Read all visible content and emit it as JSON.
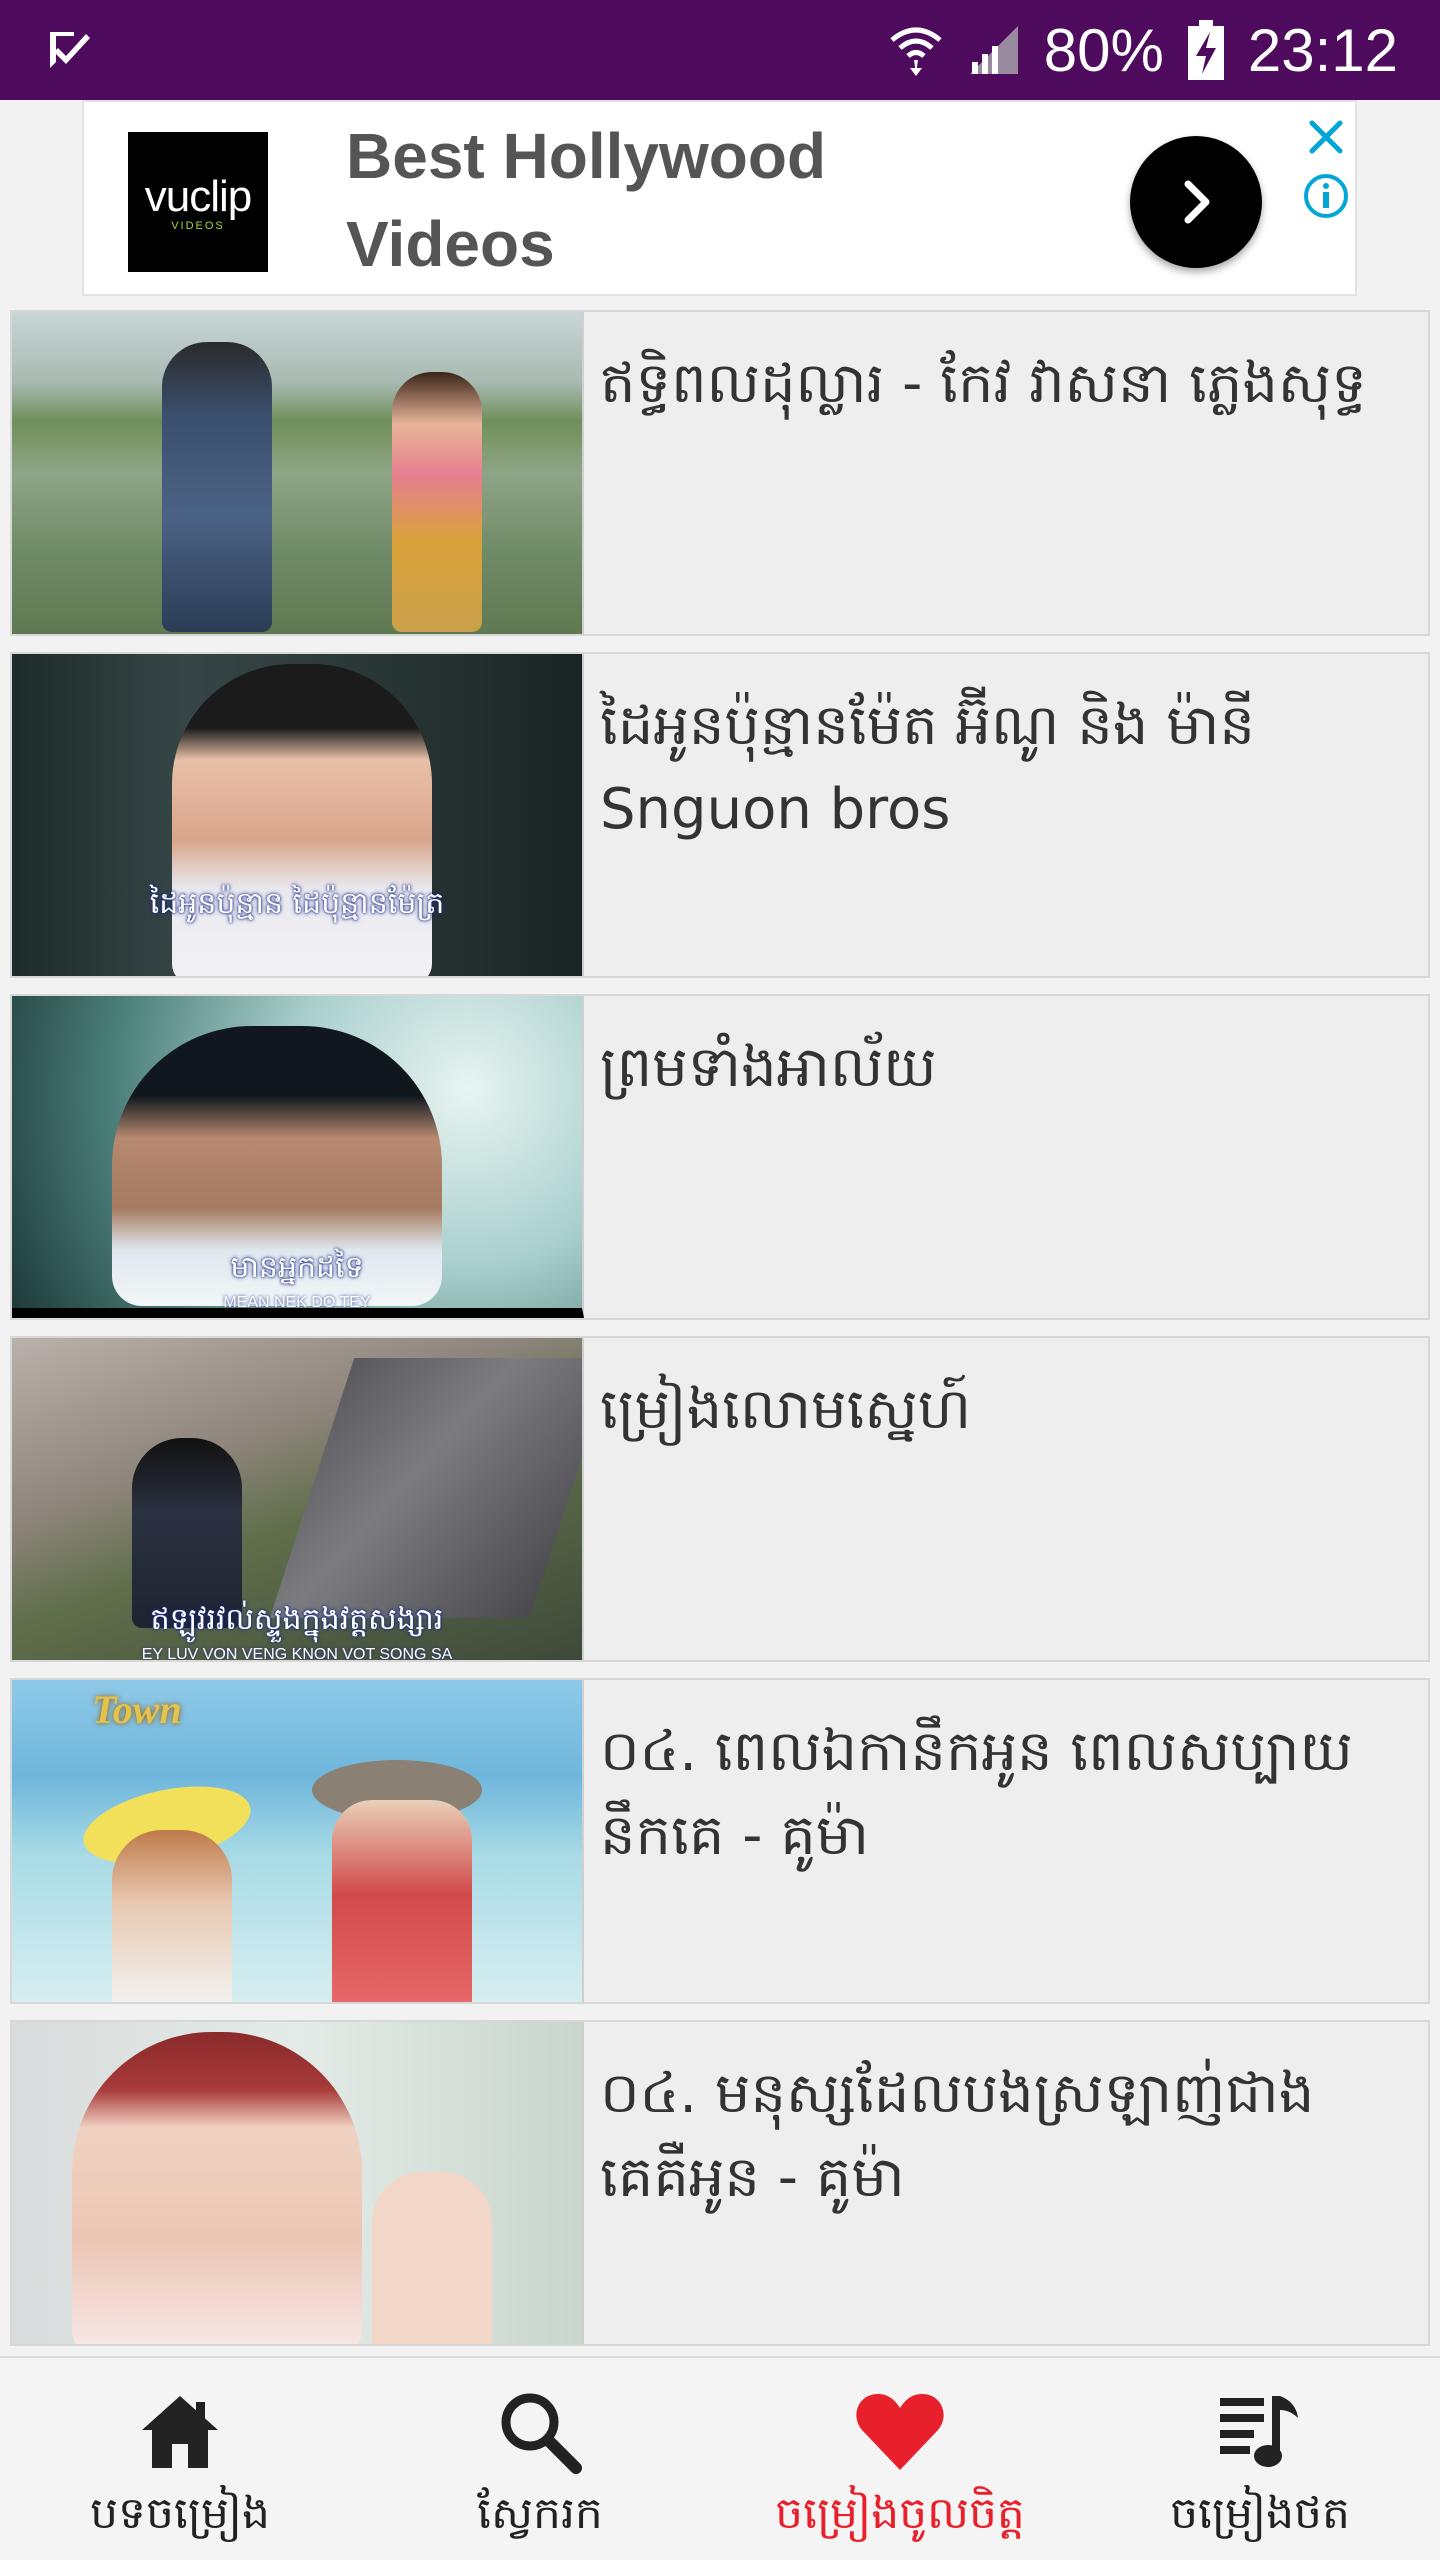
{
  "status_bar": {
    "battery": "80%",
    "time": "23:12",
    "background": "#4e0a5c"
  },
  "ad": {
    "logo_text": "vuclip",
    "logo_subtext": "VIDEOS",
    "title": "Best Hollywood Videos",
    "accent": "#00a6d6"
  },
  "videos": [
    {
      "title": "ឥទ្ធិពលដុល្លារ - កែវ វាសនា ភ្លេងសុទ្ធ",
      "thumb_caption": "",
      "thumb_subcaption": "",
      "thumb_logo": ""
    },
    {
      "title": "ដៃអូនប៉ុន្មានម៉ែត អ៊ីណូ និង ម៉ានី Snguon bros",
      "thumb_caption": "ដៃអូនប៉ុន្មាន ដៃប៉ុន្មានម៉ែត្រ",
      "thumb_subcaption": "",
      "thumb_logo": ""
    },
    {
      "title": "ព្រមទាំងអាល័យ",
      "thumb_caption": "មានអ្នកដទៃ",
      "thumb_subcaption": "MEAN NEK DO TEY",
      "thumb_logo": ""
    },
    {
      "title": "ម្រៀងលោមស្នេហ៍",
      "thumb_caption": "ឥឡូវរវល់ស្ទួងក្នុងវត្តសង្សារ",
      "thumb_subcaption": "EY LUV VON VENG KNON VOT SONG SA",
      "thumb_logo": ""
    },
    {
      "title": "០៤. ពេលឯកានឹកអូន ពេលសប្បាយនឹកគេ - គូម៉ា",
      "thumb_caption": "",
      "thumb_subcaption": "",
      "thumb_logo": "Town"
    },
    {
      "title": "០៤. មនុស្សដែលបងស្រឡាញ់ជាងគេគឺអូន - គូម៉ា",
      "thumb_caption": "",
      "thumb_subcaption": "",
      "thumb_logo": ""
    }
  ],
  "bottom_nav": {
    "items": [
      {
        "label": "បទចម្រៀង",
        "icon": "home-icon",
        "active": false
      },
      {
        "label": "ស្វែករក",
        "icon": "search-icon",
        "active": false
      },
      {
        "label": "ចម្រៀងចូលចិត្ត",
        "icon": "heart-icon",
        "active": true
      },
      {
        "label": "ចម្រៀងថត",
        "icon": "playlist-icon",
        "active": false
      }
    ],
    "active_color": "#e8202c"
  }
}
